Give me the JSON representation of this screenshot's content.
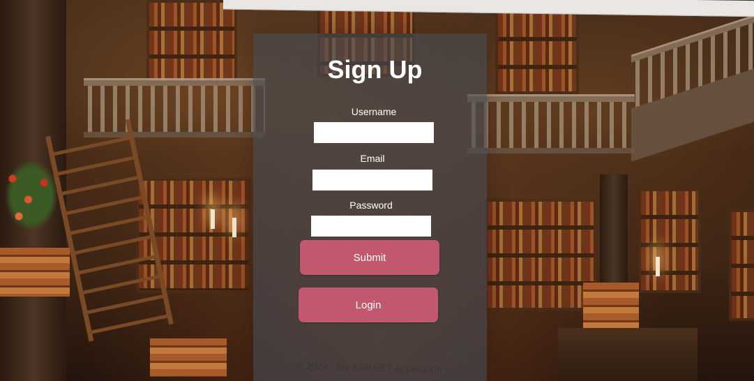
{
  "form": {
    "title": "Sign Up",
    "username_label": "Username",
    "username_value": "",
    "email_label": "Email",
    "email_value": "",
    "password_label": "Password",
    "password_value": "",
    "submit_label": "Submit",
    "login_label": "Login"
  },
  "footer": {
    "text": "© 2024 - My ASP.NET Application"
  },
  "colors": {
    "button": "#c2586d",
    "panel": "rgba(70,75,82,0.62)",
    "text": "#ffffff"
  }
}
